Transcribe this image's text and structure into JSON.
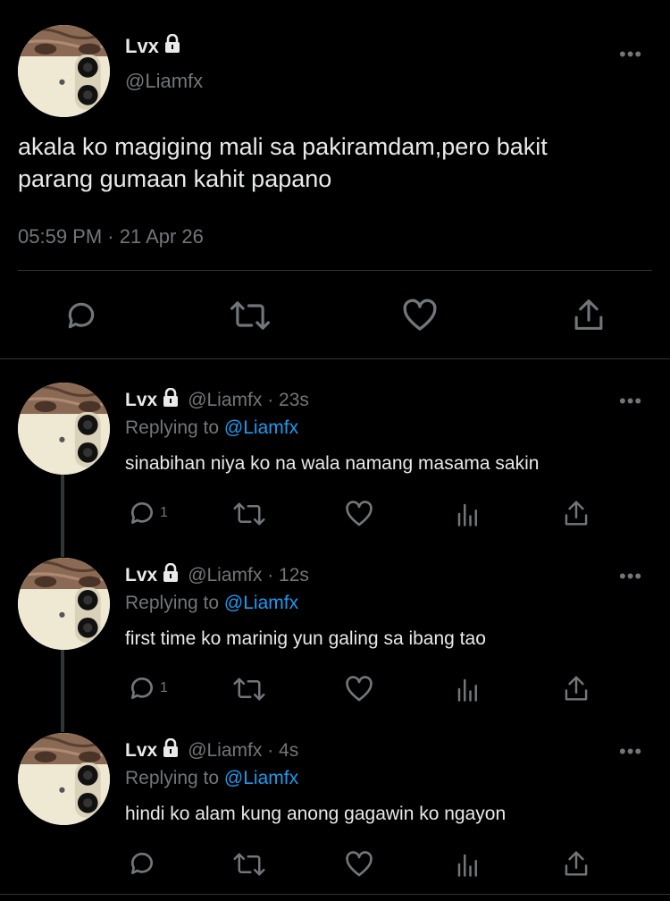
{
  "main_tweet": {
    "display_name": "Lvx",
    "handle": "@Liamfx",
    "text_line1": "akala ko magiging mali sa pakiramdam,pero bakit",
    "text_line2": "parang gumaan kahit papano",
    "timestamp": "05:59 PM · 21 Apr 26",
    "more_label": "•••"
  },
  "replies": [
    {
      "display_name": "Lvx",
      "handle_time": "@Liamfx · 23s",
      "replying_prefix": "Replying to",
      "replying_handle": "@Liamfx",
      "text": "sinabihan niya ko na wala namang masama sakin",
      "reply_count": "1",
      "more_label": "•••"
    },
    {
      "display_name": "Lvx",
      "handle_time": "@Liamfx · 12s",
      "replying_prefix": "Replying to",
      "replying_handle": "@Liamfx",
      "text": "first time ko marinig yun galing sa ibang tao",
      "reply_count": "1",
      "more_label": "•••"
    },
    {
      "display_name": "Lvx",
      "handle_time": "@Liamfx · 4s",
      "replying_prefix": "Replying to",
      "replying_handle": "@Liamfx",
      "text": "hindi ko alam kung anong gagawin ko ngayon",
      "reply_count": "",
      "more_label": "•••"
    }
  ],
  "icons": {
    "reply": "speech-bubble-icon",
    "retweet": "retweet-icon",
    "like": "heart-icon",
    "analytics": "bar-chart-icon",
    "share": "share-icon",
    "lock": "lock-icon"
  },
  "colors": {
    "background": "#000000",
    "text": "#e7e9ea",
    "secondary": "#71767b",
    "link": "#1d9bf0",
    "divider": "#2f3336"
  }
}
